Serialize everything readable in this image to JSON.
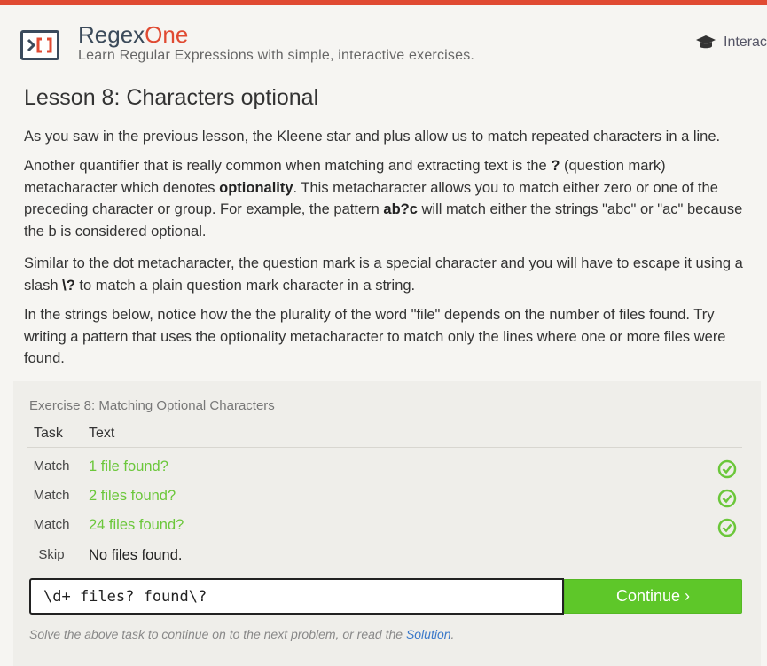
{
  "header": {
    "brand_part1": "Regex",
    "brand_part2": "One",
    "tagline": "Learn Regular Expressions with simple, interactive exercises.",
    "interactive_label": "Interac",
    "accent_color": "#e04a32"
  },
  "lesson": {
    "title": "Lesson 8: Characters optional",
    "p1": "As you saw in the previous lesson, the Kleene star and plus allow us to match repeated characters in a line.",
    "p2": {
      "a": "Another quantifier that is really common when matching and extracting text is the ",
      "b1": "?",
      "c": " (question mark) metacharacter which denotes ",
      "b2": "optionality",
      "d": ". This metacharacter allows you to match either zero or one of the preceding character or group. For example, the pattern ",
      "b3": "ab?c",
      "e": " will match either the strings \"abc\" or \"ac\" because the b is considered optional."
    },
    "p3": {
      "a": "Similar to the dot metacharacter, the question mark is a special character and you will have to escape it using a slash ",
      "b1": "\\?",
      "c": " to match a plain question mark character in a string."
    },
    "p4": "In the strings below, notice how the the plurality of the word \"file\" depends on the number of files found. Try writing a pattern that uses the optionality metacharacter to match only the lines where one or more files were found."
  },
  "exercise": {
    "title": "Exercise 8: Matching Optional Characters",
    "col_task": "Task",
    "col_text": "Text",
    "rows": [
      {
        "task": "Match",
        "text": "1 file found?",
        "done": true
      },
      {
        "task": "Match",
        "text": "2 files found?",
        "done": true
      },
      {
        "task": "Match",
        "text": "24 files found?",
        "done": true
      },
      {
        "task": "Skip",
        "text": "No files found.",
        "done": false
      }
    ],
    "input_value": "\\d+ files? found\\?",
    "continue_label": "Continue ›",
    "hint_prefix": "Solve the above task to continue on to the next problem, or read the ",
    "hint_link": "Solution",
    "hint_suffix": ".",
    "match_color": "#6bc73a",
    "button_color": "#5ec729"
  }
}
